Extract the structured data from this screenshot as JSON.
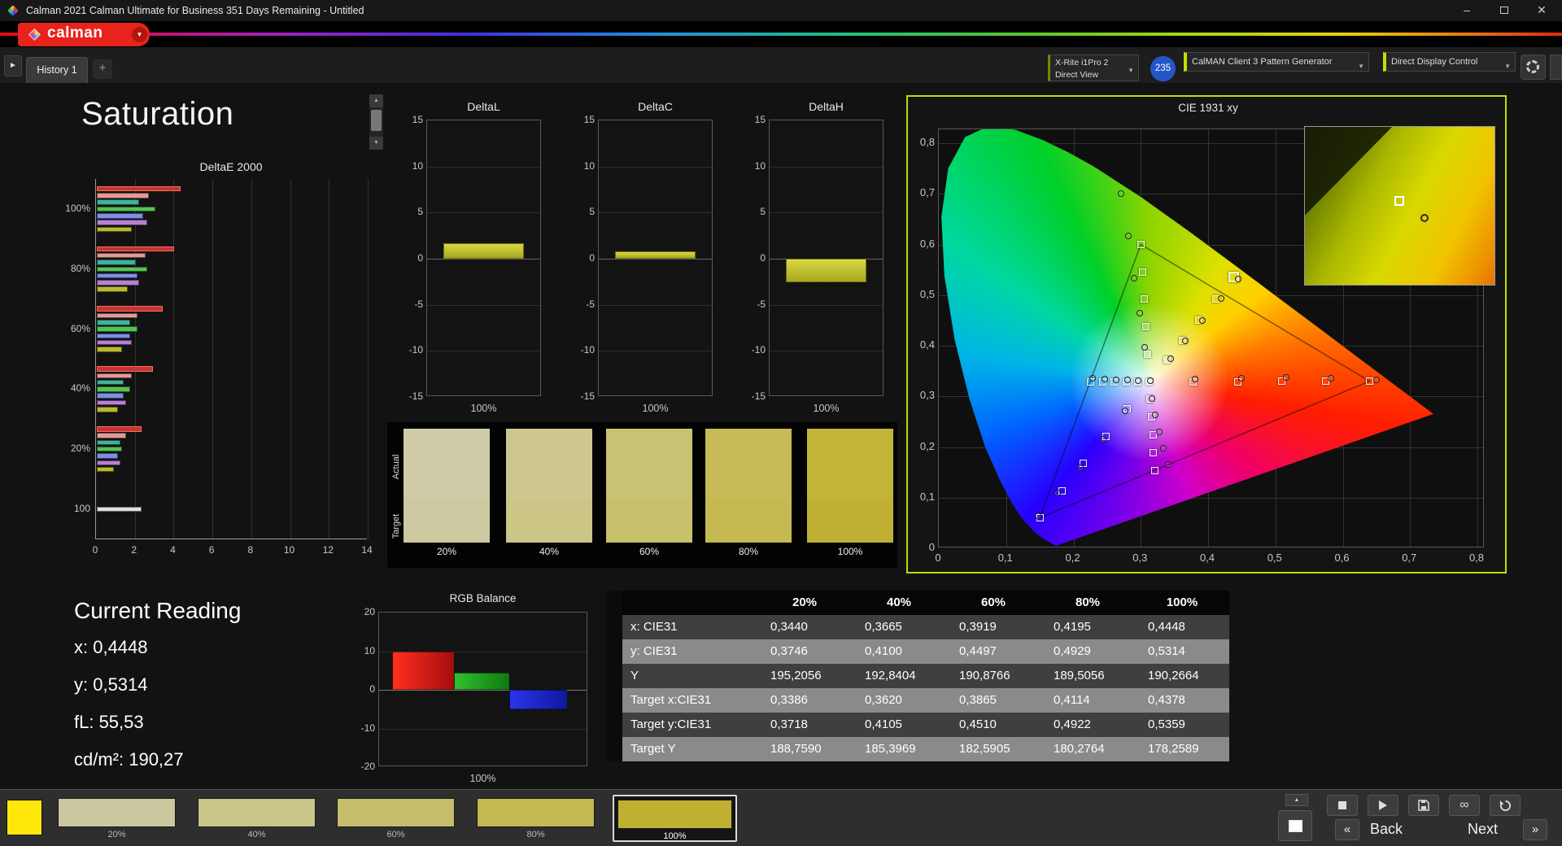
{
  "window": {
    "title": "Calman 2021 Calman Ultimate for Business 351 Days Remaining - Untitled",
    "controls": {
      "minimize": "–",
      "close": "✕"
    }
  },
  "brand": {
    "logo_text": "calman",
    "accent": "#e8231d"
  },
  "tabbar": {
    "history_tab": "History 1",
    "add_tab": "+",
    "meter_dropdown": {
      "line1": "X-Rite i1Pro 2",
      "line2": "Direct View"
    },
    "badge": "235",
    "source_dropdown": "CalMAN Client 3 Pattern Generator",
    "display_dropdown": "Direct Display Control"
  },
  "page": {
    "title": "Saturation"
  },
  "current_reading": {
    "title": "Current Reading",
    "lines": [
      "x: 0,4448",
      "y: 0,5314",
      "fL: 55,53",
      "cd/m²: 190,27"
    ]
  },
  "swatch_panel": {
    "row_labels": [
      "Actual",
      "Target"
    ],
    "columns": [
      {
        "label": "20%",
        "actual": "#cfcba6",
        "target": "#cdc9a0"
      },
      {
        "label": "40%",
        "actual": "#cdc78e",
        "target": "#cbc586"
      },
      {
        "label": "60%",
        "actual": "#c9c173",
        "target": "#c8c06c"
      },
      {
        "label": "80%",
        "actual": "#c6bb57",
        "target": "#c5ba52"
      },
      {
        "label": "100%",
        "actual": "#c2b339",
        "target": "#c0b134"
      }
    ]
  },
  "table": {
    "headers": [
      "",
      "20%",
      "40%",
      "60%",
      "80%",
      "100%"
    ],
    "rows": [
      [
        "x: CIE31",
        "0,3440",
        "0,3665",
        "0,3919",
        "0,4195",
        "0,4448"
      ],
      [
        "y: CIE31",
        "0,3746",
        "0,4100",
        "0,4497",
        "0,4929",
        "0,5314"
      ],
      [
        "Y",
        "195,2056",
        "192,8404",
        "190,8766",
        "189,5056",
        "190,2664"
      ],
      [
        "Target x:CIE31",
        "0,3386",
        "0,3620",
        "0,3865",
        "0,4114",
        "0,4378"
      ],
      [
        "Target y:CIE31",
        "0,3718",
        "0,4105",
        "0,4510",
        "0,4922",
        "0,5359"
      ],
      [
        "Target Y",
        "188,7590",
        "185,3969",
        "182,5905",
        "180,2764",
        "178,2589"
      ]
    ]
  },
  "bottombar": {
    "color_chip": "#ffe70b",
    "swatches": [
      {
        "label": "20%",
        "color": "#cbc89f",
        "selected": false
      },
      {
        "label": "40%",
        "color": "#c9c487",
        "selected": false
      },
      {
        "label": "60%",
        "color": "#c6be6c",
        "selected": false
      },
      {
        "label": "80%",
        "color": "#c3b851",
        "selected": false
      },
      {
        "label": "100%",
        "color": "#c0b032",
        "selected": true
      }
    ],
    "back_label": "Back",
    "next_label": "Next"
  },
  "chart_data": [
    {
      "id": "deltae2000",
      "type": "bar",
      "orientation": "horizontal",
      "title": "DeltaE 2000",
      "x_ticks": [
        0,
        2,
        4,
        6,
        8,
        10,
        12,
        14
      ],
      "xlim": [
        0,
        14
      ],
      "bar_colors": [
        "#c23535",
        "#e59a94",
        "#3fb39b",
        "#52c452",
        "#7b8fe6",
        "#b97fd4",
        "#b9b92e"
      ],
      "groups": [
        {
          "label": "100%",
          "values": [
            4.3,
            2.7,
            2.2,
            3.0,
            2.4,
            2.6,
            1.8
          ]
        },
        {
          "label": "80%",
          "values": [
            4.0,
            2.5,
            2.0,
            2.6,
            2.1,
            2.2,
            1.6
          ]
        },
        {
          "label": "60%",
          "values": [
            3.4,
            2.1,
            1.7,
            2.1,
            1.7,
            1.8,
            1.3
          ]
        },
        {
          "label": "40%",
          "values": [
            2.9,
            1.8,
            1.4,
            1.7,
            1.4,
            1.5,
            1.1
          ]
        },
        {
          "label": "20%",
          "values": [
            2.3,
            1.5,
            1.2,
            1.3,
            1.1,
            1.2,
            0.9
          ]
        },
        {
          "label": "100",
          "values": [
            2.3
          ],
          "colors": [
            "#e0e0e0"
          ]
        }
      ]
    },
    {
      "id": "deltaL",
      "type": "bar",
      "title": "DeltaL",
      "value": 1.7,
      "y_ticks": [
        15,
        10,
        5,
        0,
        -5,
        -10,
        -15
      ],
      "ylim": [
        -15,
        15
      ],
      "xlabel": "100%",
      "bar_color": "#b9b92e"
    },
    {
      "id": "deltaC",
      "type": "bar",
      "title": "DeltaC",
      "value": 0.8,
      "y_ticks": [
        15,
        10,
        5,
        0,
        -5,
        -10,
        -15
      ],
      "ylim": [
        -15,
        15
      ],
      "xlabel": "100%",
      "bar_color": "#b9b92e"
    },
    {
      "id": "deltaH",
      "type": "bar",
      "title": "DeltaH",
      "value": -2.6,
      "y_ticks": [
        15,
        10,
        5,
        0,
        -5,
        -10,
        -15
      ],
      "ylim": [
        -15,
        15
      ],
      "xlabel": "100%",
      "bar_color": "#b9b92e"
    },
    {
      "id": "rgb_balance",
      "type": "bar",
      "title": "RGB Balance",
      "y_ticks": [
        20,
        10,
        0,
        -10,
        -20
      ],
      "ylim": [
        -20,
        20
      ],
      "xlabel": "100%",
      "series": [
        {
          "name": "Red",
          "value": 10,
          "color": "#ff3020",
          "color_dark": "#a80d0d"
        },
        {
          "name": "Green",
          "value": 4.5,
          "color": "#2ec22e",
          "color_dark": "#0f7a0f"
        },
        {
          "name": "Blue",
          "value": -5,
          "color": "#2a35e8",
          "color_dark": "#0f18a0"
        }
      ]
    },
    {
      "id": "cie",
      "type": "scatter",
      "title": "CIE 1931 xy",
      "x_tick_labels": [
        "0",
        "0,1",
        "0,2",
        "0,3",
        "0,4",
        "0,5",
        "0,6",
        "0,7",
        "0,8"
      ],
      "y_tick_labels": [
        "0,8",
        "0,7",
        "0,6",
        "0,5",
        "0,4",
        "0,3",
        "0,2",
        "0,1",
        "0"
      ],
      "xlim": [
        0,
        0.8
      ],
      "ylim": [
        0,
        0.8
      ],
      "white_point": [
        0.3127,
        0.329
      ],
      "gamut_triangle": [
        [
          0.64,
          0.33
        ],
        [
          0.3,
          0.6
        ],
        [
          0.15,
          0.06
        ]
      ],
      "locus": [
        [
          0.1741,
          0.005
        ],
        [
          0.1566,
          0.0177
        ],
        [
          0.144,
          0.0297
        ],
        [
          0.1241,
          0.0578
        ],
        [
          0.1096,
          0.0868
        ],
        [
          0.0913,
          0.1327
        ],
        [
          0.0687,
          0.2007
        ],
        [
          0.0454,
          0.295
        ],
        [
          0.0235,
          0.4127
        ],
        [
          0.0082,
          0.5384
        ],
        [
          0.0039,
          0.6548
        ],
        [
          0.0139,
          0.7502
        ],
        [
          0.0389,
          0.812
        ],
        [
          0.0743,
          0.8338
        ],
        [
          0.1142,
          0.8262
        ],
        [
          0.1547,
          0.8059
        ],
        [
          0.1929,
          0.7816
        ],
        [
          0.2296,
          0.7543
        ],
        [
          0.3016,
          0.6923
        ],
        [
          0.3731,
          0.6245
        ],
        [
          0.4441,
          0.5547
        ],
        [
          0.5125,
          0.4866
        ],
        [
          0.5752,
          0.4242
        ],
        [
          0.627,
          0.3725
        ],
        [
          0.6915,
          0.3083
        ],
        [
          0.7347,
          0.2653
        ]
      ],
      "target_points": [
        [
          0.378,
          0.329
        ],
        [
          0.444,
          0.329
        ],
        [
          0.509,
          0.33
        ],
        [
          0.575,
          0.33
        ],
        [
          0.64,
          0.33
        ],
        [
          0.31,
          0.383
        ],
        [
          0.308,
          0.437
        ],
        [
          0.305,
          0.492
        ],
        [
          0.303,
          0.546
        ],
        [
          0.3,
          0.6
        ],
        [
          0.28,
          0.275
        ],
        [
          0.248,
          0.221
        ],
        [
          0.215,
          0.168
        ],
        [
          0.183,
          0.114
        ],
        [
          0.15,
          0.06
        ],
        [
          0.295,
          0.329
        ],
        [
          0.278,
          0.329
        ],
        [
          0.26,
          0.329
        ],
        [
          0.243,
          0.329
        ],
        [
          0.225,
          0.329
        ],
        [
          0.314,
          0.294
        ],
        [
          0.316,
          0.259
        ],
        [
          0.318,
          0.224
        ],
        [
          0.319,
          0.189
        ],
        [
          0.321,
          0.154
        ],
        [
          0.3386,
          0.3718
        ],
        [
          0.362,
          0.4105
        ],
        [
          0.3865,
          0.451
        ],
        [
          0.4114,
          0.4922
        ],
        [
          0.3127,
          0.329
        ]
      ],
      "measured_points": [
        [
          0.381,
          0.334
        ],
        [
          0.449,
          0.336
        ],
        [
          0.516,
          0.337
        ],
        [
          0.583,
          0.336
        ],
        [
          0.65,
          0.333
        ],
        [
          0.306,
          0.396
        ],
        [
          0.298,
          0.464
        ],
        [
          0.29,
          0.534
        ],
        [
          0.281,
          0.617
        ],
        [
          0.271,
          0.701
        ],
        [
          0.277,
          0.271
        ],
        [
          0.244,
          0.215
        ],
        [
          0.21,
          0.159
        ],
        [
          0.177,
          0.109
        ],
        [
          0.147,
          0.064
        ],
        [
          0.296,
          0.331
        ],
        [
          0.28,
          0.332
        ],
        [
          0.263,
          0.333
        ],
        [
          0.246,
          0.334
        ],
        [
          0.229,
          0.335
        ],
        [
          0.317,
          0.296
        ],
        [
          0.322,
          0.263
        ],
        [
          0.328,
          0.23
        ],
        [
          0.334,
          0.197
        ],
        [
          0.341,
          0.166
        ],
        [
          0.344,
          0.3746
        ],
        [
          0.3665,
          0.41
        ],
        [
          0.3919,
          0.4497
        ],
        [
          0.4195,
          0.4929
        ],
        [
          0.314,
          0.331
        ]
      ],
      "current_target": [
        0.4378,
        0.5359
      ],
      "current_measured": [
        0.4448,
        0.5314
      ]
    }
  ]
}
